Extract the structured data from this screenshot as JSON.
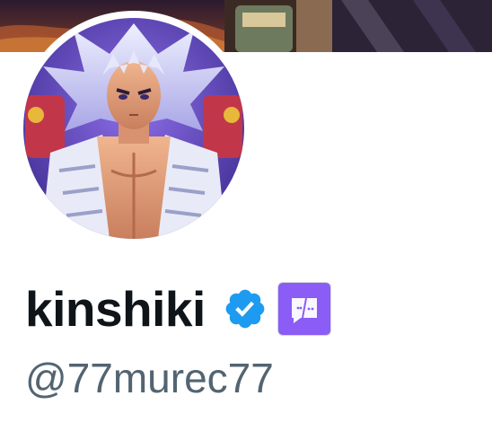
{
  "profile": {
    "display_name": "kinshiki",
    "handle": "@77murec77",
    "verified": true,
    "verified_badge_color": "#1d9bf0",
    "affiliate_badge_color": "#8b5cf6"
  },
  "icons": {
    "verified": "verified-badge-icon",
    "affiliate": "affiliate-badge-icon"
  }
}
